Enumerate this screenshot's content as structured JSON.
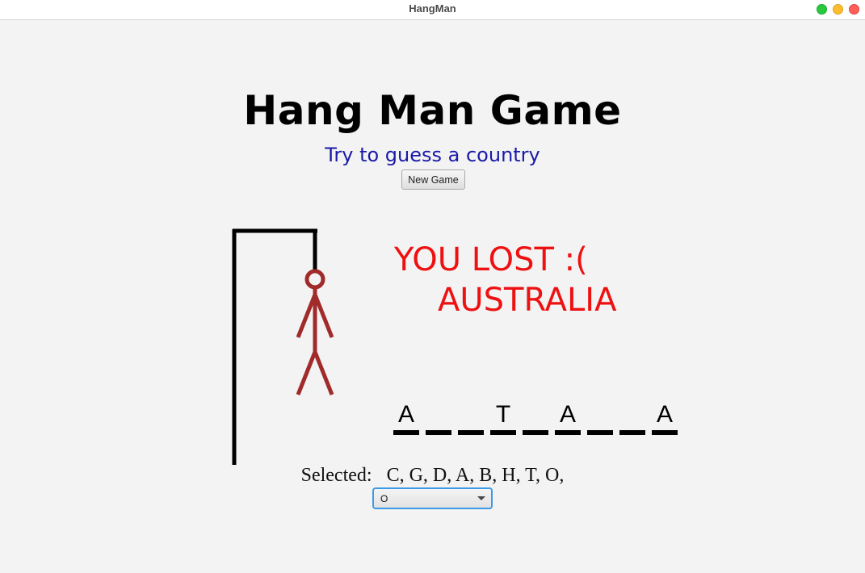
{
  "window": {
    "title": "HangMan"
  },
  "header": {
    "title": "Hang Man Game",
    "subtitle": "Try to guess a country",
    "new_game_label": "New Game"
  },
  "result": {
    "line1": "YOU LOST :(",
    "line2": "AUSTRALIA",
    "color": "#ee1111"
  },
  "word": {
    "slots": [
      "A",
      "",
      "",
      "T",
      "",
      "A",
      "",
      "",
      "A"
    ]
  },
  "selected": {
    "label": "Selected:",
    "letters": "C, G, D, A, B, H, T, O,"
  },
  "letter_select": {
    "value": "O"
  },
  "colors": {
    "figure": "#a12a2a",
    "subtitle": "#1a1aa8",
    "focus": "#3c9be8"
  }
}
